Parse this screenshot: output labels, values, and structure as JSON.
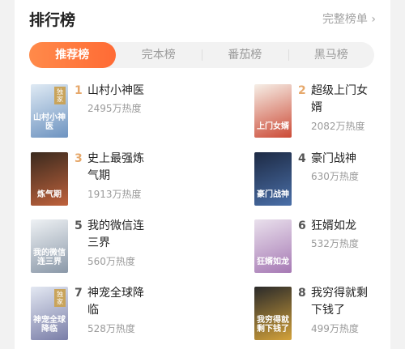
{
  "header": {
    "title": "排行榜",
    "more": "完整榜单",
    "more_icon": "chevron-right"
  },
  "tabs": [
    {
      "label": "推荐榜",
      "active": true
    },
    {
      "label": "完本榜",
      "active": false
    },
    {
      "label": "番茄榜",
      "active": false
    },
    {
      "label": "黑马榜",
      "active": false
    }
  ],
  "books": [
    {
      "rank": "1",
      "title": "山村小神医",
      "heat": "2495万热度",
      "cover_text": "山村小神医",
      "badge": "独家",
      "rank_color": "#e6a86b",
      "cover_colors": [
        "#dfeaf4",
        "#6d93c0"
      ]
    },
    {
      "rank": "2",
      "title": "超级上门女婿",
      "heat": "2082万热度",
      "cover_text": "上门女婿",
      "badge": "",
      "rank_color": "#e6a86b",
      "cover_colors": [
        "#f6efe7",
        "#cc4a36"
      ]
    },
    {
      "rank": "3",
      "title": "史上最强炼气期",
      "heat": "1913万热度",
      "cover_text": "炼气期",
      "badge": "",
      "rank_color": "#e6a86b",
      "cover_colors": [
        "#3a2a1e",
        "#c0623c"
      ]
    },
    {
      "rank": "4",
      "title": "豪门战神",
      "heat": "630万热度",
      "cover_text": "豪门战神",
      "badge": "",
      "rank_color": "#555555",
      "cover_colors": [
        "#1d2a44",
        "#4a6fa8"
      ]
    },
    {
      "rank": "5",
      "title": "我的微信连三界",
      "heat": "560万热度",
      "cover_text": "我的微信连三界",
      "badge": "",
      "rank_color": "#555555",
      "cover_colors": [
        "#eef1f4",
        "#8a98a8"
      ]
    },
    {
      "rank": "6",
      "title": "狂婿如龙",
      "heat": "532万热度",
      "cover_text": "狂婿如龙",
      "badge": "",
      "rank_color": "#555555",
      "cover_colors": [
        "#e9e0ec",
        "#a679b4"
      ]
    },
    {
      "rank": "7",
      "title": "神宠全球降临",
      "heat": "528万热度",
      "cover_text": "神宠全球降临",
      "badge": "独家",
      "rank_color": "#555555",
      "cover_colors": [
        "#e3e8f2",
        "#7a7ea8"
      ]
    },
    {
      "rank": "8",
      "title": "我穷得就剩下钱了",
      "heat": "499万热度",
      "cover_text": "我穷得就剩下钱了",
      "badge": "",
      "rank_color": "#555555",
      "cover_colors": [
        "#2a2a2a",
        "#d4a23a"
      ]
    }
  ]
}
